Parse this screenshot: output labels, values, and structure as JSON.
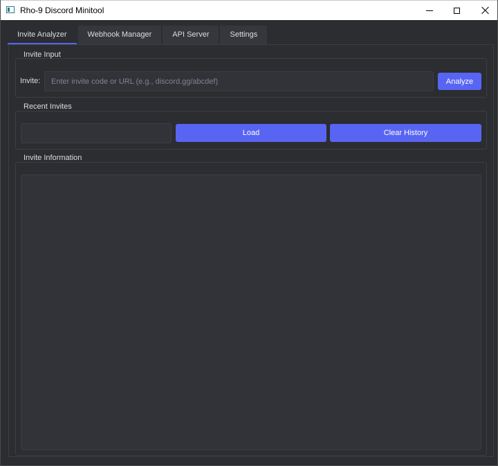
{
  "window": {
    "title": "Rho-9 Discord Minitool"
  },
  "tabs": [
    {
      "label": "Invite Analyzer",
      "active": true
    },
    {
      "label": "Webhook Manager",
      "active": false
    },
    {
      "label": "API Server",
      "active": false
    },
    {
      "label": "Settings",
      "active": false
    }
  ],
  "invite_input": {
    "group_title": "Invite Input",
    "label": "Invite:",
    "value": "",
    "placeholder": "Enter invite code or URL (e.g., discord.gg/abcdef)",
    "analyze_label": "Analyze"
  },
  "recent_invites": {
    "group_title": "Recent Invites",
    "selected": "",
    "load_label": "Load",
    "clear_label": "Clear History"
  },
  "invite_information": {
    "group_title": "Invite Information",
    "content": ""
  },
  "colors": {
    "accent": "#5865f2",
    "background": "#2b2d31",
    "field": "#313338"
  }
}
